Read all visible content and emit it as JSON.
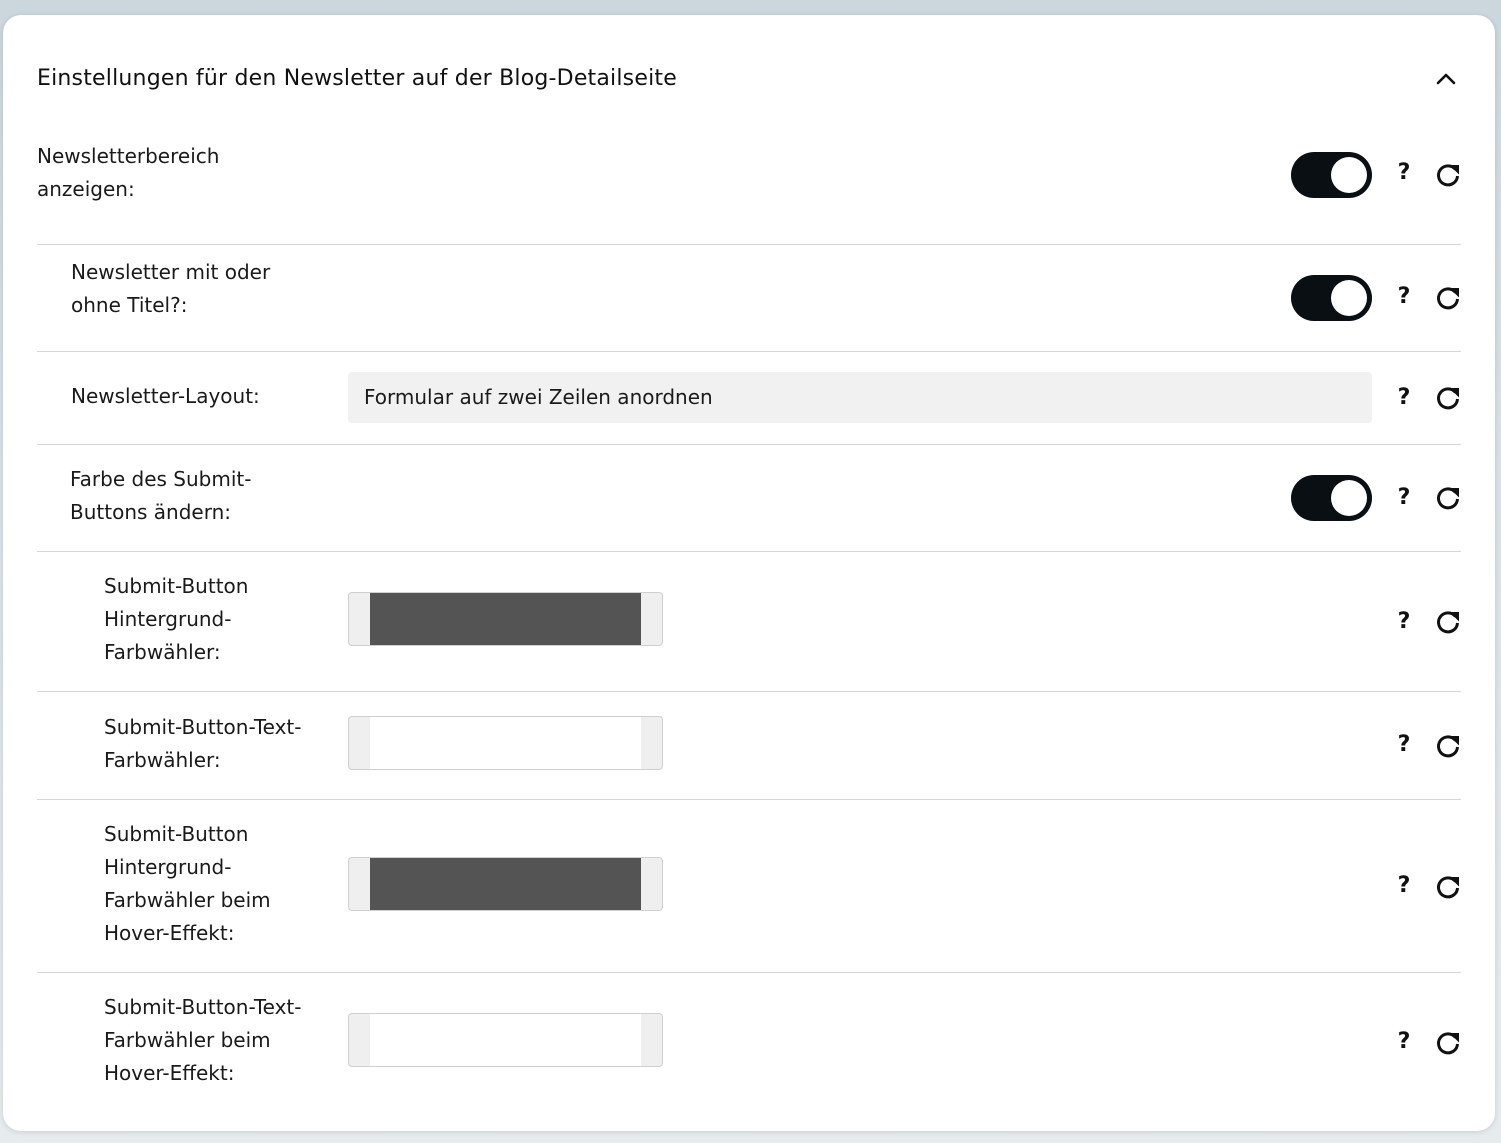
{
  "panel": {
    "title": "Einstellungen für den Newsletter auf der Blog-Detailseite"
  },
  "rows": [
    {
      "label": "Newsletterbereich\nanzeigen:",
      "type": "toggle",
      "value": true
    },
    {
      "label": "Newsletter mit oder\nohne Titel?:",
      "type": "toggle",
      "value": true
    },
    {
      "label": "Newsletter-Layout:",
      "type": "select",
      "value": "Formular auf zwei Zeilen anordnen"
    },
    {
      "label": "Farbe des Submit-\nButtons ändern:",
      "type": "toggle",
      "value": true
    },
    {
      "label": "Submit-Button\nHintergrund-\nFarbwähler:",
      "type": "color",
      "value": "#545454"
    },
    {
      "label": "Submit-Button-Text-\nFarbwähler:",
      "type": "color",
      "value": "#ffffff"
    },
    {
      "label": "Submit-Button\nHintergrund-\nFarbwähler beim\nHover-Effekt:",
      "type": "color",
      "value": "#545454"
    },
    {
      "label": "Submit-Button-Text-\nFarbwähler beim\nHover-Effekt:",
      "type": "color",
      "value": "#ffffff"
    }
  ],
  "help_symbol": "?",
  "icons": {
    "collapse": "chevron-up-icon",
    "reset": "refresh-icon",
    "help": "question-mark-icon"
  },
  "colors": {
    "toggle_on": "#0a0f14",
    "select_bg": "#f1f1f1",
    "divider": "#d6d6d6"
  }
}
